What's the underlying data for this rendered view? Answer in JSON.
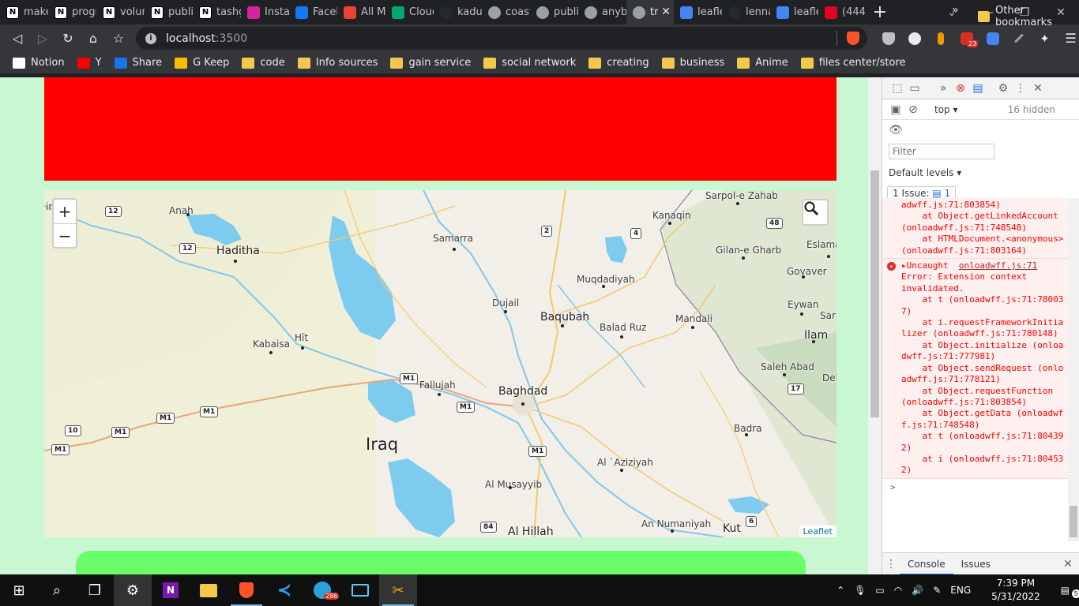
{
  "browser": {
    "tabs": [
      {
        "title": "make",
        "icon": "notion-icon",
        "color": "#ffffff"
      },
      {
        "title": "progr",
        "icon": "notion-icon",
        "color": "#ffffff"
      },
      {
        "title": "volun",
        "icon": "notion-icon",
        "color": "#ffffff"
      },
      {
        "title": "publi",
        "icon": "notion-icon",
        "color": "#ffffff"
      },
      {
        "title": "tashg",
        "icon": "notion-icon",
        "color": "#ffffff"
      },
      {
        "title": "Insta",
        "icon": "instagram-icon",
        "color": "#d6249f"
      },
      {
        "title": "Faceb",
        "icon": "facebook-icon",
        "color": "#1877f2"
      },
      {
        "title": "All M",
        "icon": "gmail-icon",
        "color": "#ea4335"
      },
      {
        "title": "Cloud",
        "icon": "leaf-icon",
        "color": "#00a86b"
      },
      {
        "title": "kadut",
        "icon": "github-icon",
        "color": "#24292e"
      },
      {
        "title": "coast",
        "icon": "globe-icon",
        "color": "#9aa0a6"
      },
      {
        "title": "publi",
        "icon": "globe-icon",
        "color": "#9aa0a6"
      },
      {
        "title": "anybo",
        "icon": "globe-icon",
        "color": "#9aa0a6"
      },
      {
        "title": "tr",
        "icon": "globe-icon",
        "color": "#9aa0a6",
        "active": true
      },
      {
        "title": "leafle",
        "icon": "google-icon",
        "color": "#4285f4"
      },
      {
        "title": "lenna",
        "icon": "github-icon",
        "color": "#24292e"
      },
      {
        "title": "leafle",
        "icon": "google-icon",
        "color": "#4285f4"
      },
      {
        "title": "(444)",
        "icon": "pinterest-icon",
        "color": "#e60023"
      }
    ],
    "address": {
      "host": "localhost",
      "port": ":3500"
    },
    "bookmarks": [
      {
        "label": "Notion",
        "icon": "notion-icon",
        "color": "#ffffff"
      },
      {
        "label": "Y",
        "icon": "youtube-icon",
        "color": "#ff0000"
      },
      {
        "label": "Share",
        "icon": "share-icon",
        "color": "#1a73e8"
      },
      {
        "label": "G Keep",
        "icon": "keep-icon",
        "color": "#fbbc04"
      },
      {
        "label": "code",
        "icon": "folder-icon"
      },
      {
        "label": "Info sources",
        "icon": "folder-icon"
      },
      {
        "label": "gain service",
        "icon": "folder-icon"
      },
      {
        "label": "social network",
        "icon": "folder-icon"
      },
      {
        "label": "creating",
        "icon": "folder-icon"
      },
      {
        "label": "business",
        "icon": "folder-icon"
      },
      {
        "label": "Anime",
        "icon": "folder-icon"
      },
      {
        "label": "files center/store",
        "icon": "folder-icon"
      }
    ],
    "other_bookmarks": "Other bookmarks",
    "more_bookmarks": "»",
    "ext_badge": "23"
  },
  "map": {
    "zoom_in": "+",
    "zoom_out": "−",
    "attribution": "Leaflet",
    "country": "Iraq",
    "cities": [
      {
        "name": "Baghdad",
        "cls": "mid"
      },
      {
        "name": "Baqubah",
        "cls": "mid"
      },
      {
        "name": "Haditha",
        "cls": "mid"
      },
      {
        "name": "Fallujah",
        "cls": ""
      },
      {
        "name": "Samarra",
        "cls": ""
      },
      {
        "name": "Anah",
        "cls": ""
      },
      {
        "name": "Hīt",
        "cls": ""
      },
      {
        "name": "Kabaisa",
        "cls": ""
      },
      {
        "name": "Dujail",
        "cls": ""
      },
      {
        "name": "Muqdadiyah",
        "cls": ""
      },
      {
        "name": "Balad Ruz",
        "cls": ""
      },
      {
        "name": "Mandali",
        "cls": ""
      },
      {
        "name": "Kanaqin",
        "cls": ""
      },
      {
        "name": "Sarpol-e Zahab",
        "cls": ""
      },
      {
        "name": "Gilan-e Gharb",
        "cls": ""
      },
      {
        "name": "Eslamabad-e Gharb",
        "cls": ""
      },
      {
        "name": "Govaver",
        "cls": ""
      },
      {
        "name": "Eywan",
        "cls": ""
      },
      {
        "name": "Sara",
        "cls": ""
      },
      {
        "name": "Ilam",
        "cls": "mid"
      },
      {
        "name": "Saleh Abad",
        "cls": ""
      },
      {
        "name": "Del",
        "cls": ""
      },
      {
        "name": "Badra",
        "cls": ""
      },
      {
        "name": "Al `Aziziyah",
        "cls": ""
      },
      {
        "name": "Al Musayyib",
        "cls": ""
      },
      {
        "name": "Al Hillah",
        "cls": "mid"
      },
      {
        "name": "An Numaniyah",
        "cls": ""
      },
      {
        "name": "Kut",
        "cls": "mid"
      },
      {
        "name": "im",
        "cls": ""
      }
    ],
    "shields": [
      "12",
      "12",
      "2",
      "4",
      "48",
      "M1",
      "M1",
      "M1",
      "M1",
      "M1",
      "M1",
      "10",
      "M1",
      "17",
      "6",
      "84"
    ]
  },
  "devtools": {
    "top_select": "top",
    "hidden": "16 hidden",
    "filter_placeholder": "Filter",
    "levels": "Default levels",
    "issues": "1 Issue:",
    "issues_count": "1",
    "log_lines": [
      "adwff.js:71:803854)",
      "    at Object.getLinkedAccount (onloadwff.js:71:748548)",
      "    at HTMLDocument.<anonymous> (onloadwff.js:71:803164)"
    ],
    "error": {
      "source": "onloadwff.js:71",
      "head": "Uncaught",
      "message": "Error: Extension context invalidated.",
      "stack": [
        "    at t (onloadwff.js:71:780037)",
        "    at i.requestFrameworkInitializer (onloadwff.js:71:780148)",
        "    at Object.initialize (onloadwff.js:71:777981)",
        "    at Object.sendRequest (onloadwff.js:71:778121)",
        "    at Object.requestFunction (onloadwff.js:71:803854)",
        "    at Object.getData (onloadwff.js:71:748548)",
        "    at t (onloadwff.js:71:804392)",
        "    at i (onloadwff.js:71:804532)"
      ]
    },
    "prompt": ">",
    "drawer_tabs": [
      "Console",
      "Issues"
    ]
  },
  "taskbar": {
    "language": "ENG",
    "time": "7:39 PM",
    "date": "5/31/2022",
    "notification_count": "5",
    "telegram_badge": "286"
  }
}
